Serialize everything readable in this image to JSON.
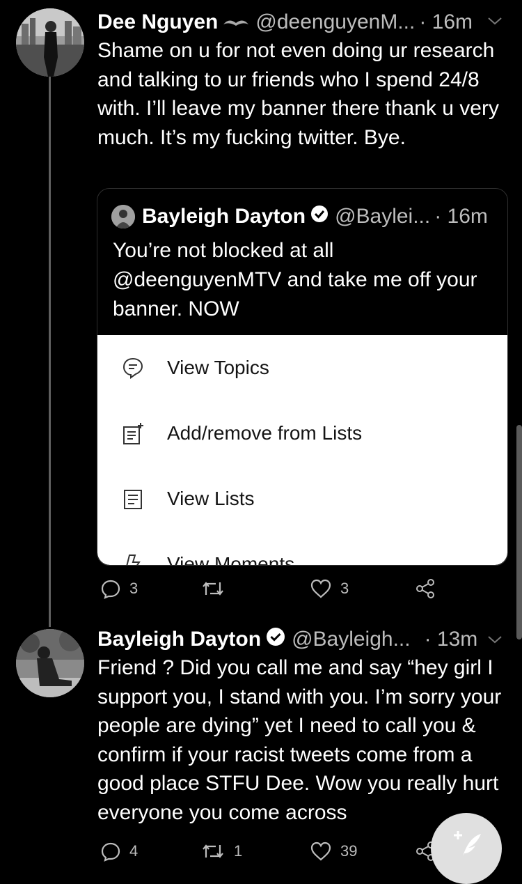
{
  "tweet1": {
    "name": "Dee Nguyen",
    "handle": "@deenguyenM...",
    "time": "· 16m",
    "text": "Shame on u for not even doing ur research and talking to ur friends who I spend 24/8 with. I’ll leave my banner there thank u very much. It’s my fucking twitter. Bye.",
    "quote": {
      "name": "Bayleigh Dayton",
      "handle": "@Baylei...",
      "time": "· 16m",
      "text": "You’re not blocked at all @deenguyenMTV and take me off your banner. NOW"
    },
    "actions": {
      "replies": "3",
      "retweets": "",
      "likes": "3"
    }
  },
  "menu": {
    "items": [
      {
        "label": "View Topics",
        "icon": "topic-bubble-icon"
      },
      {
        "label": "Add/remove from Lists",
        "icon": "list-add-icon"
      },
      {
        "label": "View Lists",
        "icon": "list-icon"
      },
      {
        "label": "View Moments",
        "icon": "lightning-icon"
      }
    ]
  },
  "tweet2": {
    "name": "Bayleigh Dayton",
    "handle": "@Bayleigh...",
    "time": "· 13m",
    "text": "Friend ? Did you call me and say “hey girl I support you, I stand with you. I’m sorry your people are dying” yet I need to call you & confirm if your racist tweets come from a good place STFU Dee. Wow you really hurt everyone you come across",
    "actions": {
      "replies": "4",
      "retweets": "1",
      "likes": "39"
    }
  },
  "colors": {
    "background": "#000000",
    "secondary_text": "#bdbdbd",
    "menu_bg": "#ffffff",
    "fab": "#e0e0e0"
  }
}
